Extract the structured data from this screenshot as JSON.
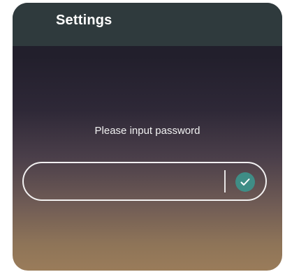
{
  "header": {
    "title": "Settings"
  },
  "prompt": {
    "text": "Please input password"
  },
  "password_field": {
    "value": "",
    "placeholder": ""
  },
  "confirm_button": {
    "icon": "check-icon",
    "color": "#3f8d86"
  },
  "colors": {
    "header_bg": "#2f3a3d",
    "text": "#ffffff"
  }
}
